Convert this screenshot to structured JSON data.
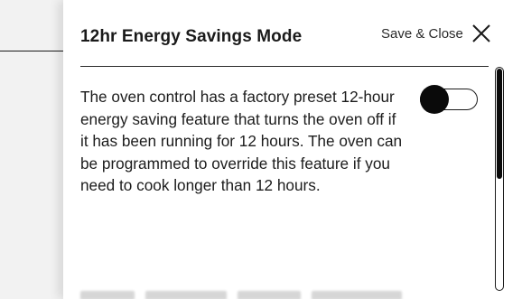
{
  "header": {
    "title": "12hr Energy Savings Mode",
    "save_close_label": "Save & Close",
    "close_icon": "close-x-icon"
  },
  "setting": {
    "description": "The oven control has a factory preset 12-hour energy saving feature that turns the oven off if it has been running for 12 hours. The oven can be programmed to override this feature if you need to cook longer than 12  hours.",
    "toggle_state": "on"
  },
  "colors": {
    "text": "#1c1c1c",
    "panel_bg": "#ffffff",
    "backdrop_bg": "#f2f2f2",
    "control": "#0a0a0a"
  }
}
